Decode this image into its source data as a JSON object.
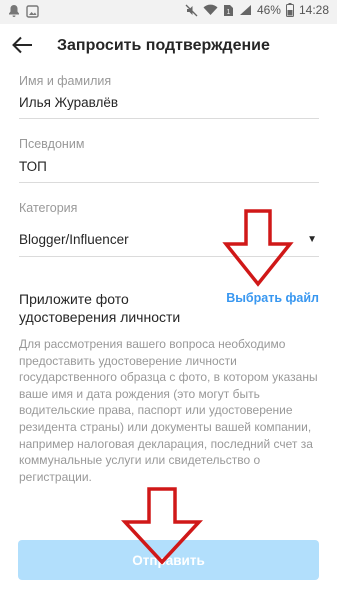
{
  "status_bar": {
    "battery_percent": "46%",
    "time": "14:28",
    "sim_badge": "1"
  },
  "header": {
    "title": "Запросить подтверждение"
  },
  "form": {
    "name_label": "Имя и фамилия",
    "name_value": "Илья Журавлёв",
    "nickname_label": "Псевдоним",
    "nickname_value": "ТОП",
    "category_label": "Категория",
    "category_value": "Blogger/Influencer",
    "attach_title": "Приложите фото удостоверения личности",
    "choose_file_label": "Выбрать файл",
    "description": "Для рассмотрения вашего вопроса необходимо предоставить удостоверение личности государственного образца с фото, в котором указаны ваше имя и дата рождения (это могут быть водительские права, паспорт или удостоверение резидента страны) или документы вашей компании, например налоговая декларация, последний счет за коммунальные услуги или свидетельство о регистрации.",
    "submit_label": "Отправить"
  },
  "colors": {
    "link": "#3897f0",
    "submit_disabled": "#b2dffc",
    "annotation_arrow": "#d01818"
  },
  "icons": [
    "notification-icon",
    "gallery-icon",
    "mute-icon",
    "wifi-icon",
    "sim-icon",
    "signal-icon",
    "battery-icon",
    "back-arrow-icon",
    "dropdown-caret-icon",
    "annotation-arrow-icon"
  ]
}
